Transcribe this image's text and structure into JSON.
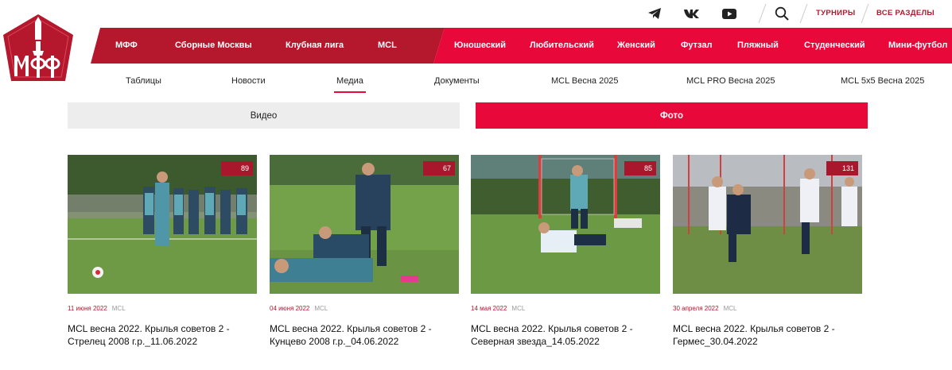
{
  "topbar": {
    "social": [
      "telegram-icon",
      "vk-icon",
      "youtube-icon"
    ],
    "tournaments": "ТУРНИРЫ",
    "all_sections": "ВСЕ РАЗДЕЛЫ"
  },
  "main_nav": [
    "МФФ",
    "Сборные Москвы",
    "Клубная лига",
    "MCL",
    "Юношеский",
    "Любительский",
    "Женский",
    "Футзал",
    "Пляжный",
    "Студенческий",
    "Мини-футбол"
  ],
  "sub_nav": [
    "Таблицы",
    "Новости",
    "Медиа",
    "Документы",
    "MCL Весна 2025",
    "MCL PRO Весна 2025",
    "MCL 5x5 Весна 2025"
  ],
  "media_tabs": {
    "video": "Видео",
    "photo": "Фото"
  },
  "albums": [
    {
      "count": "89",
      "date": "11 июня 2022",
      "category": "MCL",
      "title_line1": "MCL весна 2022. Крылья советов 2 -",
      "title_line2": "Стрелец 2008 г.р._11.06.2022"
    },
    {
      "count": "67",
      "date": "04 июня 2022",
      "category": "MCL",
      "title_line1": "MCL весна 2022. Крылья советов 2 -",
      "title_line2": "Кунцево 2008 г.р._04.06.2022"
    },
    {
      "count": "85",
      "date": "14 мая 2022",
      "category": "MCL",
      "title_line1": "MCL весна 2022. Крылья советов 2 -",
      "title_line2": "Северная звезда_14.05.2022"
    },
    {
      "count": "131",
      "date": "30 апреля 2022",
      "category": "MCL",
      "title_line1": "MCL весна 2022. Крылья советов 2 -",
      "title_line2": "Гермес_30.04.2022"
    }
  ],
  "colors": {
    "brand_dark": "#b5172d",
    "brand_bright": "#e8083a"
  }
}
